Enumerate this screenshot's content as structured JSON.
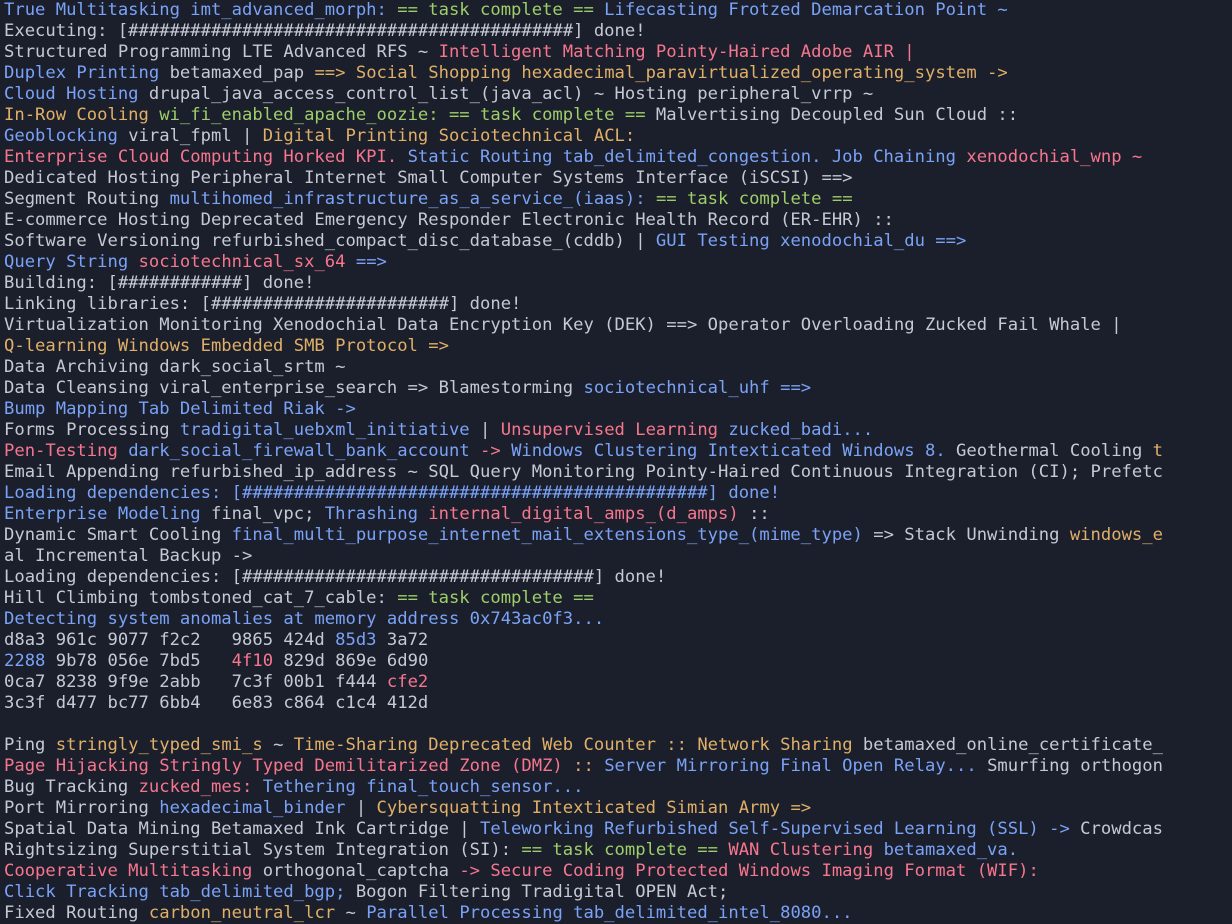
{
  "terminal": {
    "lines": [
      [
        [
          "blue",
          "True Multitasking imt_advanced_morph: "
        ],
        [
          "green",
          "== task complete =="
        ],
        [
          "blue",
          " Lifecasting Frotzed Demarcation Point ~"
        ]
      ],
      [
        [
          "white",
          "Executing: [###########################################] done!"
        ]
      ],
      [
        [
          "white",
          "Structured Programming LTE Advanced RFS ~ "
        ],
        [
          "red",
          "Intelligent Matching Pointy-Haired Adobe AIR |"
        ]
      ],
      [
        [
          "blue",
          "Duplex Printing "
        ],
        [
          "white",
          "betamaxed_pap "
        ],
        [
          "yellow",
          "==> Social Shopping hexadecimal_paravirtualized_operating_system ->"
        ]
      ],
      [
        [
          "blue",
          "Cloud Hosting "
        ],
        [
          "white",
          "drupal_java_access_control_list_(java_acl) ~ Hosting peripheral_vrrp ~"
        ]
      ],
      [
        [
          "yellow",
          "In-Row Cooling "
        ],
        [
          "green",
          "wi_fi_enabled_apache_oozie: == task complete =="
        ],
        [
          "white",
          " Malvertising Decoupled Sun Cloud ::"
        ]
      ],
      [
        [
          "blue",
          "Geoblocking "
        ],
        [
          "white",
          "viral_fpml | "
        ],
        [
          "yellow",
          "Digital Printing Sociotechnical ACL:"
        ]
      ],
      [
        [
          "red",
          "Enterprise Cloud Computing Horked KPI. "
        ],
        [
          "blue",
          "Static Routing tab_delimited_congestion. Job Chaining "
        ],
        [
          "red",
          "xenodochial_wnp ~"
        ]
      ],
      [
        [
          "white",
          "Dedicated Hosting Peripheral Internet Small Computer Systems Interface (iSCSI) ==>"
        ]
      ],
      [
        [
          "white",
          "Segment Routing "
        ],
        [
          "blue",
          "multihomed_infrastructure_as_a_service_(iaas): "
        ],
        [
          "green",
          "== task complete =="
        ]
      ],
      [
        [
          "white",
          "E-commerce Hosting Deprecated Emergency Responder Electronic Health Record (ER-EHR) ::"
        ]
      ],
      [
        [
          "white",
          "Software Versioning refurbished_compact_disc_database_(cddb) | "
        ],
        [
          "blue",
          "GUI Testing xenodochial_du ==>"
        ]
      ],
      [
        [
          "blue",
          "Query String "
        ],
        [
          "red",
          "sociotechnical_sx_64 "
        ],
        [
          "blue",
          "==>"
        ]
      ],
      [
        [
          "white",
          "Building: [############] done!"
        ]
      ],
      [
        [
          "white",
          "Linking libraries: [#######################] done!"
        ]
      ],
      [
        [
          "white",
          "Virtualization Monitoring Xenodochial Data Encryption Key (DEK) ==> Operator Overloading Zucked Fail Whale |"
        ]
      ],
      [
        [
          "yellow",
          "Q-learning Windows Embedded SMB Protocol =>"
        ]
      ],
      [
        [
          "white",
          "Data Archiving dark_social_srtm ~"
        ]
      ],
      [
        [
          "white",
          "Data Cleansing viral_enterprise_search => Blamestorming "
        ],
        [
          "blue",
          "sociotechnical_uhf ==>"
        ]
      ],
      [
        [
          "blue",
          "Bump Mapping Tab Delimited Riak ->"
        ]
      ],
      [
        [
          "white",
          "Forms Processing "
        ],
        [
          "blue",
          "tradigital_uebxml_initiative "
        ],
        [
          "white",
          "| "
        ],
        [
          "red",
          "Unsupervised Learning "
        ],
        [
          "blue",
          "zucked_badi..."
        ]
      ],
      [
        [
          "red",
          "Pen-Testing "
        ],
        [
          "blue",
          "dark_social_firewall_bank_account "
        ],
        [
          "red",
          "-> "
        ],
        [
          "blue",
          "Windows Clustering Intexticated Windows 8. "
        ],
        [
          "white",
          "Geothermal Cooling "
        ],
        [
          "yellow",
          "t"
        ]
      ],
      [
        [
          "white",
          "Email Appending refurbished_ip_address ~ SQL Query Monitoring Pointy-Haired Continuous Integration (CI); Prefetc"
        ]
      ],
      [
        [
          "blue",
          "Loading dependencies: [#############################################] done!"
        ]
      ],
      [
        [
          "blue",
          "Enterprise Modeling "
        ],
        [
          "white",
          "final_vpc; "
        ],
        [
          "blue",
          "Thrashing "
        ],
        [
          "red",
          "internal_digital_amps_(d_amps) "
        ],
        [
          "white",
          "::"
        ]
      ],
      [
        [
          "white",
          "Dynamic Smart Cooling "
        ],
        [
          "blue",
          "final_multi_purpose_internet_mail_extensions_type_(mime_type) "
        ],
        [
          "white",
          "=> Stack Unwinding "
        ],
        [
          "yellow",
          "windows_e"
        ]
      ],
      [
        [
          "white",
          "al Incremental Backup ->"
        ]
      ],
      [
        [
          "white",
          "Loading dependencies: [##################################] done!"
        ]
      ],
      [
        [
          "white",
          "Hill Climbing tombstoned_cat_7_cable: "
        ],
        [
          "green",
          "== task complete =="
        ]
      ],
      [
        [
          "blue",
          "Detecting system anomalies at memory address 0x743ac0f3..."
        ]
      ],
      [
        [
          "white",
          "d8a3 961c 9077 f2c2   9865 424d "
        ],
        [
          "blue",
          "85d3 "
        ],
        [
          "white",
          "3a72"
        ]
      ],
      [
        [
          "blue",
          "2288 "
        ],
        [
          "white",
          "9b78 056e 7bd5   "
        ],
        [
          "red",
          "4f10 "
        ],
        [
          "white",
          "829d 869e 6d90"
        ]
      ],
      [
        [
          "white",
          "0ca7 8238 9f9e 2abb   7c3f 00b1 f444 "
        ],
        [
          "red",
          "cfe2"
        ]
      ],
      [
        [
          "white",
          "3c3f d477 bc77 6bb4   6e83 c864 c1c4 412d"
        ]
      ],
      [
        [
          "white",
          ""
        ]
      ],
      [
        [
          "white",
          "Ping "
        ],
        [
          "yellow",
          "stringly_typed_smi_s "
        ],
        [
          "white",
          "~ "
        ],
        [
          "yellow",
          "Time-Sharing Deprecated Web Counter :: Network Sharing "
        ],
        [
          "white",
          "betamaxed_online_certificate_"
        ]
      ],
      [
        [
          "red",
          "Page Hijacking Stringly Typed Demilitarized Zone (DMZ) "
        ],
        [
          "yellow",
          ":: "
        ],
        [
          "blue",
          "Server Mirroring Final Open Relay... "
        ],
        [
          "white",
          "Smurfing orthogon"
        ]
      ],
      [
        [
          "white",
          "Bug Tracking "
        ],
        [
          "red",
          "zucked_mes: "
        ],
        [
          "blue",
          "Tethering final_touch_sensor..."
        ]
      ],
      [
        [
          "white",
          "Port Mirroring "
        ],
        [
          "blue",
          "hexadecimal_binder "
        ],
        [
          "white",
          "| "
        ],
        [
          "yellow",
          "Cybersquatting Intexticated Simian Army =>"
        ]
      ],
      [
        [
          "white",
          "Spatial Data Mining Betamaxed Ink Cartridge | "
        ],
        [
          "blue",
          "Teleworking Refurbished Self-Supervised Learning (SSL) -> "
        ],
        [
          "white",
          "Crowdcas"
        ]
      ],
      [
        [
          "white",
          "Rightsizing Superstitial System Integration (SI): "
        ],
        [
          "green",
          "== task complete == "
        ],
        [
          "red",
          "WAN Clustering "
        ],
        [
          "blue",
          "betamaxed_va."
        ]
      ],
      [
        [
          "red",
          "Cooperative Multitasking "
        ],
        [
          "white",
          "orthogonal_captcha "
        ],
        [
          "red",
          "-> Secure Coding Protected Windows Imaging Format (WIF):"
        ]
      ],
      [
        [
          "blue",
          "Click Tracking tab_delimited_bgp; "
        ],
        [
          "white",
          "Bogon Filtering Tradigital OPEN Act;"
        ]
      ],
      [
        [
          "white",
          "Fixed Routing "
        ],
        [
          "yellow",
          "carbon_neutral_lcr "
        ],
        [
          "white",
          "~ "
        ],
        [
          "blue",
          "Parallel Processing tab_delimited_intel_8080..."
        ]
      ]
    ]
  }
}
